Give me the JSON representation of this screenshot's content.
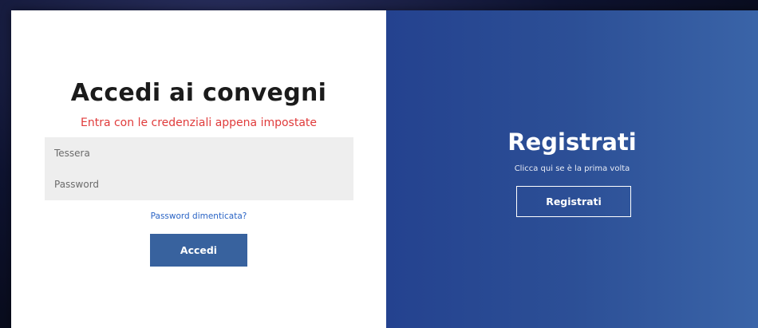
{
  "login": {
    "title": "Accedi ai convegni",
    "subtitle": "Entra con le credenziali appena impostate",
    "tessera_placeholder": "Tessera",
    "password_placeholder": "Password",
    "forgot_link": "Password dimenticata?",
    "submit_label": "Accedi"
  },
  "register": {
    "title": "Registrati",
    "subtitle": "Clicca qui se è la prima volta",
    "button_label": "Registrati"
  },
  "colors": {
    "subtitle_red": "#e03b3b",
    "link_blue": "#2a64c5",
    "button_blue": "#38629e",
    "panel_blue": "#2c4f96"
  }
}
